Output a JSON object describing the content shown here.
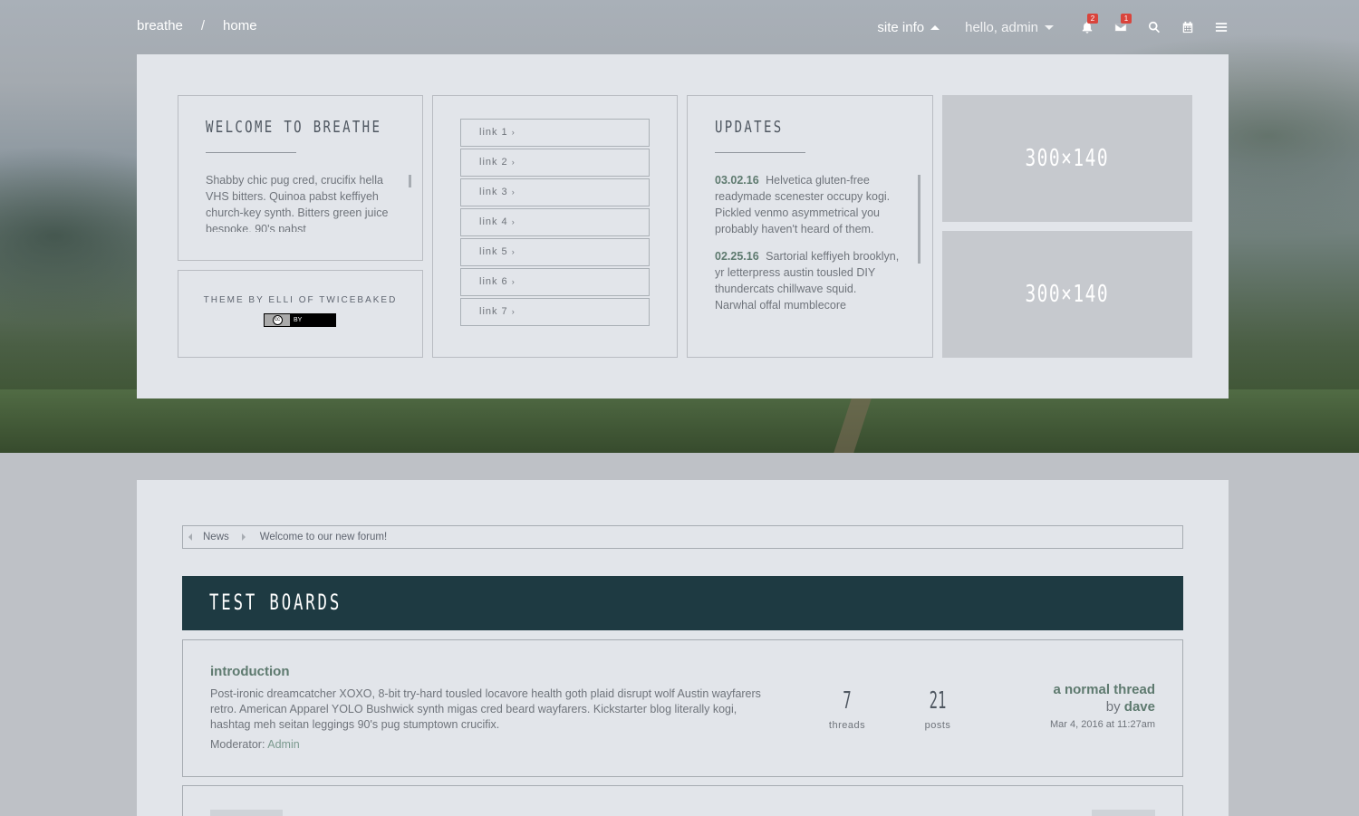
{
  "nav": {
    "crumb_site": "breathe",
    "crumb_sep": "/",
    "crumb_page": "home",
    "site_info": "site info",
    "greeting": "hello, admin",
    "notifications_count": "2",
    "messages_count": "1",
    "icons": [
      "bell-icon",
      "envelope-icon",
      "search-icon",
      "calendar-icon",
      "menu-icon"
    ]
  },
  "welcome": {
    "title": "WELCOME TO BREATHE",
    "text": "Shabby chic pug cred, crucifix hella VHS bitters. Quinoa pabst keffiyeh church-key synth. Bitters green juice bespoke, 90's pabst"
  },
  "theme": {
    "credit": "THEME BY ELLI OF TWICEBAKED",
    "license": "BY"
  },
  "links": [
    "link 1",
    "link 2",
    "link 3",
    "link 4",
    "link 5",
    "link 6",
    "link 7"
  ],
  "link_chevron": "›",
  "updates": {
    "title": "UPDATES",
    "entries": [
      {
        "date": "03.02.16",
        "text": "Helvetica gluten-free readymade scenester occupy kogi. Pickled venmo asymmetrical you probably haven't heard of them."
      },
      {
        "date": "02.25.16",
        "text": "Sartorial keffiyeh brooklyn, yr letterpress austin tousled DIY thundercats chillwave squid. Narwhal offal mumblecore"
      }
    ]
  },
  "ads": [
    "300×140",
    "300×140"
  ],
  "forum": {
    "breadcrumb": [
      "News",
      "Welcome to our new forum!"
    ],
    "category": "TEST BOARDS",
    "boards": [
      {
        "name": "introduction",
        "description": "Post-ironic dreamcatcher XOXO, 8-bit try-hard tousled locavore health goth plaid disrupt wolf Austin wayfarers retro. American Apparel YOLO Bushwick synth migas cred beard wayfarers. Kickstarter blog literally kogi, hashtag meh seitan leggings 90's pug stumptown crucifix.",
        "moderator_label": "Moderator:",
        "moderator": "Admin",
        "threads": "7",
        "threads_label": "threads",
        "posts": "21",
        "posts_label": "posts",
        "last_thread": "a normal thread",
        "by_label": "by",
        "last_author": "dave",
        "last_time": "Mar 4, 2016 at 11:27am"
      }
    ]
  },
  "colors": {
    "panel": "#e2e5ea",
    "category_header": "#1e3a42",
    "accent_green": "#5e7a6f",
    "badge_red": "#d9443c"
  }
}
